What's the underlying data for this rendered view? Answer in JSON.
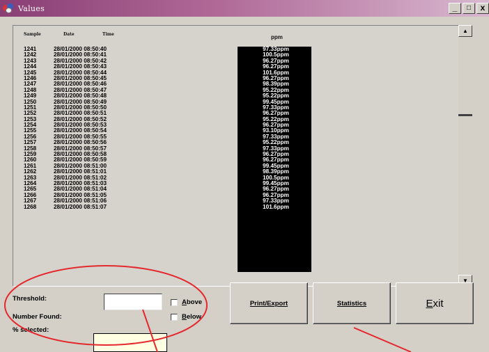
{
  "window": {
    "title": "Values",
    "minimize_glyph": "_",
    "maximize_glyph": "□",
    "close_glyph": "x"
  },
  "list": {
    "headers": {
      "sample": "Sample",
      "date": "Date",
      "time": "Time",
      "ppm": "ppm"
    },
    "rows": [
      {
        "sample": "1241",
        "datetime": "28/01/2000 08:50:40",
        "ppm": "97.33ppm"
      },
      {
        "sample": "1242",
        "datetime": "28/01/2000 08:50:41",
        "ppm": "100.5ppm"
      },
      {
        "sample": "1243",
        "datetime": "28/01/2000 08:50:42",
        "ppm": "96.27ppm"
      },
      {
        "sample": "1244",
        "datetime": "28/01/2000 08:50:43",
        "ppm": "96.27ppm"
      },
      {
        "sample": "1245",
        "datetime": "28/01/2000 08:50:44",
        "ppm": "101.6ppm"
      },
      {
        "sample": "1246",
        "datetime": "28/01/2000 08:50:45",
        "ppm": "96.27ppm"
      },
      {
        "sample": "1247",
        "datetime": "28/01/2000 08:50:46",
        "ppm": "98.39ppm"
      },
      {
        "sample": "1248",
        "datetime": "28/01/2000 08:50:47",
        "ppm": "95.22ppm"
      },
      {
        "sample": "1249",
        "datetime": "28/01/2000 08:50:48",
        "ppm": "95.22ppm"
      },
      {
        "sample": "1250",
        "datetime": "28/01/2000 08:50:49",
        "ppm": "99.45ppm"
      },
      {
        "sample": "1251",
        "datetime": "28/01/2000 08:50:50",
        "ppm": "97.33ppm"
      },
      {
        "sample": "1252",
        "datetime": "28/01/2000 08:50:51",
        "ppm": "96.27ppm"
      },
      {
        "sample": "1253",
        "datetime": "28/01/2000 08:50:52",
        "ppm": "95.22ppm"
      },
      {
        "sample": "1254",
        "datetime": "28/01/2000 08:50:53",
        "ppm": "96.27ppm"
      },
      {
        "sample": "1255",
        "datetime": "28/01/2000 08:50:54",
        "ppm": "93.10ppm"
      },
      {
        "sample": "1256",
        "datetime": "28/01/2000 08:50:55",
        "ppm": "97.33ppm"
      },
      {
        "sample": "1257",
        "datetime": "28/01/2000 08:50:56",
        "ppm": "95.22ppm"
      },
      {
        "sample": "1258",
        "datetime": "28/01/2000 08:50:57",
        "ppm": "97.33ppm"
      },
      {
        "sample": "1259",
        "datetime": "28/01/2000 08:50:58",
        "ppm": "96.27ppm"
      },
      {
        "sample": "1260",
        "datetime": "28/01/2000 08:50:59",
        "ppm": "96.27ppm"
      },
      {
        "sample": "1261",
        "datetime": "28/01/2000 08:51:00",
        "ppm": "99.45ppm"
      },
      {
        "sample": "1262",
        "datetime": "28/01/2000 08:51:01",
        "ppm": "98.39ppm"
      },
      {
        "sample": "1263",
        "datetime": "28/01/2000 08:51:02",
        "ppm": "100.5ppm"
      },
      {
        "sample": "1264",
        "datetime": "28/01/2000 08:51:03",
        "ppm": "99.45ppm"
      },
      {
        "sample": "1265",
        "datetime": "28/01/2000 08:51:04",
        "ppm": "96.27ppm"
      },
      {
        "sample": "1266",
        "datetime": "28/01/2000 08:51:05",
        "ppm": "96.27ppm"
      },
      {
        "sample": "1267",
        "datetime": "28/01/2000 08:51:06",
        "ppm": "97.33ppm"
      },
      {
        "sample": "1268",
        "datetime": "28/01/2000 08:51:07",
        "ppm": "101.6ppm"
      }
    ]
  },
  "scrollbar": {
    "up_glyph": "▲",
    "down_glyph": "▼"
  },
  "controls": {
    "threshold_label": "Threshold:",
    "threshold_value": "",
    "number_found_label": "Number Found:",
    "percent_selected_label": "% selected:",
    "above_label_u": "A",
    "above_label_rest": "bove",
    "below_label_u": "B",
    "below_label_rest": "elow"
  },
  "buttons": {
    "print_export": "Print/Export",
    "statistics": "Statistics",
    "exit_u": "E",
    "exit_rest": "xit"
  },
  "annotation_color": "#e5282e"
}
